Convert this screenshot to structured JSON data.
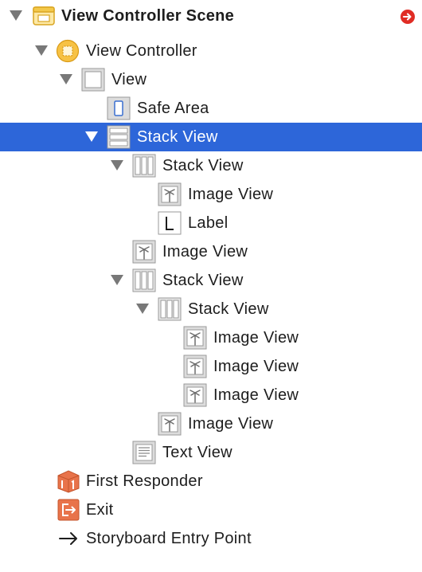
{
  "outline": {
    "scene_title": "View Controller Scene",
    "items": [
      {
        "label": "View Controller Scene",
        "icon": "scene-icon"
      },
      {
        "label": "View Controller",
        "icon": "view-controller-icon"
      },
      {
        "label": "View",
        "icon": "view-icon"
      },
      {
        "label": "Safe Area",
        "icon": "safe-area-icon"
      },
      {
        "label": "Stack View",
        "icon": "vertical-stack-view-icon",
        "selected": true
      },
      {
        "label": "Stack View",
        "icon": "horizontal-stack-view-icon"
      },
      {
        "label": "Image View",
        "icon": "image-view-icon"
      },
      {
        "label": "Label",
        "icon": "label-icon"
      },
      {
        "label": "Image View",
        "icon": "image-view-icon"
      },
      {
        "label": "Stack View",
        "icon": "horizontal-stack-view-icon"
      },
      {
        "label": "Stack View",
        "icon": "horizontal-stack-view-icon"
      },
      {
        "label": "Image View",
        "icon": "image-view-icon"
      },
      {
        "label": "Image View",
        "icon": "image-view-icon"
      },
      {
        "label": "Image View",
        "icon": "image-view-icon"
      },
      {
        "label": "Image View",
        "icon": "image-view-icon"
      },
      {
        "label": "Text View",
        "icon": "text-view-icon"
      },
      {
        "label": "First Responder",
        "icon": "first-responder-icon"
      },
      {
        "label": "Exit",
        "icon": "exit-icon"
      },
      {
        "label": "Storyboard Entry Point",
        "icon": "arrow-right-icon"
      }
    ]
  },
  "colors": {
    "selection": "#2d66d9",
    "warning_badge": "#e02c24",
    "scene_icon": "#f3c84a",
    "exit_icon": "#e8734a"
  }
}
